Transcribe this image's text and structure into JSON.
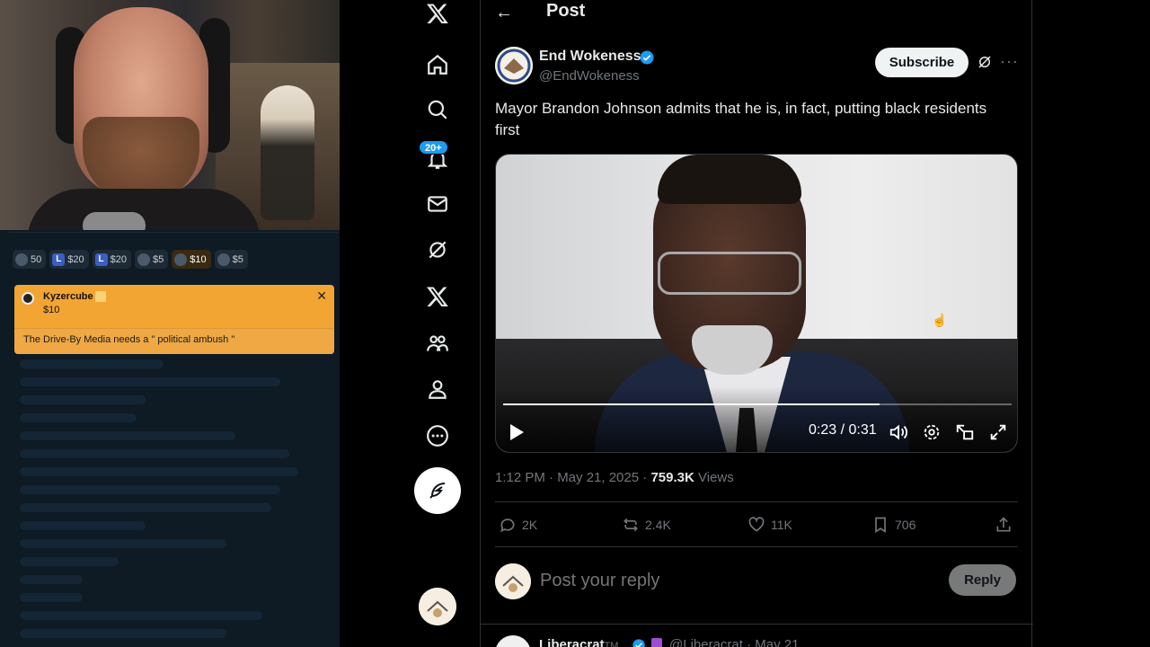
{
  "stream": {
    "tips": [
      {
        "icon": "avatar",
        "label": "50"
      },
      {
        "icon": "L",
        "label": "$20"
      },
      {
        "icon": "L",
        "label": "$20"
      },
      {
        "icon": "avatar",
        "label": "$5"
      },
      {
        "icon": "avatar",
        "label": "$10"
      },
      {
        "icon": "avatar",
        "label": "$5"
      }
    ],
    "donation": {
      "name": "Kyzercube",
      "amount": "$10",
      "message": "The Drive-By Media needs a \" political ambush \""
    }
  },
  "nav": {
    "notifications_badge": "20+"
  },
  "post": {
    "header_title": "Post",
    "author_name": "End Wokeness",
    "author_handle": "@EndWokeness",
    "subscribe_label": "Subscribe",
    "text": "Mayor Brandon Johnson admits that he is, in fact, putting black residents first",
    "video": {
      "time": "0:23 / 0:31",
      "progress": 0.74
    },
    "timestamp": "1:12 PM · May 21, 2025",
    "separator": " · ",
    "views_count": "759.3K",
    "views_label": " Views",
    "stats": {
      "replies": "2K",
      "reposts": "2.4K",
      "likes": "11K",
      "bookmarks": "706"
    },
    "reply_placeholder": "Post your reply",
    "reply_button": "Reply"
  },
  "next_reply": {
    "name": "Liberacrat",
    "name_suffix": "TM",
    "handle": "@Liberacrat · May 21"
  },
  "colors": {
    "accent": "#1d9bf0",
    "donation": "#f3a533",
    "background": "#000000"
  }
}
